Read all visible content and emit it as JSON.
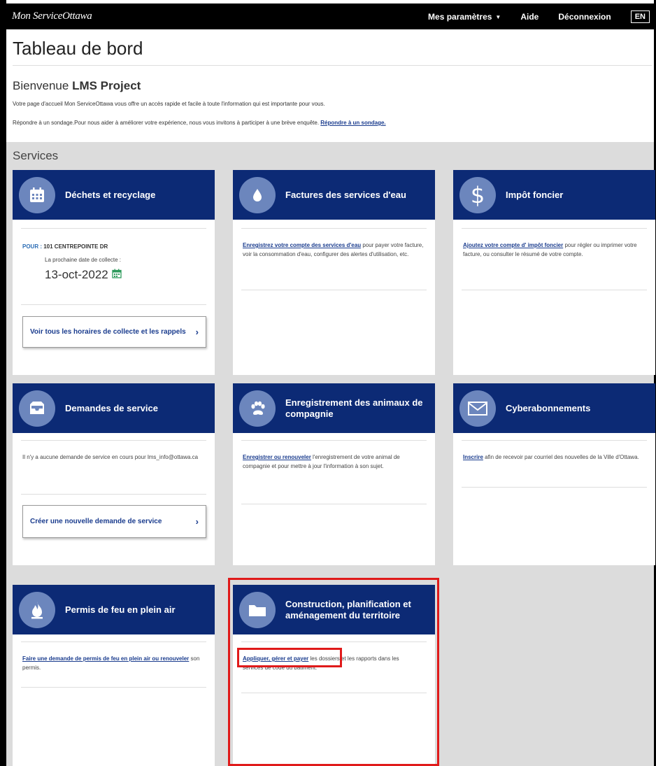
{
  "topbar": {
    "logo": "Mon ServiceOttawa",
    "settings_label": "Mes paramètres",
    "help_label": "Aide",
    "logout_label": "Déconnexion",
    "lang_label": "EN"
  },
  "header": {
    "title": "Tableau de bord",
    "welcome_prefix": "Bienvenue ",
    "welcome_name": "LMS Project",
    "intro": "Votre page d'accueil Mon ServiceOttawa vous offre un accès rapide et facile à toute l'information qui est importante pour vous.",
    "survey_text": "Répondre à un sondage.Pour nous aider à améliorer votre expérience, nous vous invitons à participer à une brève enquête. ",
    "survey_link": "Répondre à un sondage."
  },
  "services": {
    "title": "Services",
    "waste": {
      "title": "Déchets et recyclage",
      "pour_label": "POUR :",
      "address": "101 CENTREPOINTE DR",
      "next_label": "La prochaine date de collecte :",
      "next_date": "13-oct-2022",
      "button": "Voir tous les horaires de collecte et les rappels"
    },
    "water": {
      "title": "Factures des services d'eau",
      "link": "Enregistrez votre compte des services d'eau",
      "text": " pour payer votre facture, voir la consommation d'eau, configurer des alertes d'utilisation, etc."
    },
    "tax": {
      "title": "Impôt foncier",
      "link": "Ajoutez votre compte d' impôt foncier",
      "text": " pour régler ou imprimer votre facture, ou consulter le résumé de votre compte."
    },
    "requests": {
      "title": "Demandes de service",
      "text": "Il n'y a aucune demande de service en cours pour lms_info@ottawa.ca",
      "button": "Créer une nouvelle demande de service"
    },
    "pets": {
      "title": "Enregistrement des animaux de compagnie",
      "link": "Enregistrer ou renouveler",
      "text": " l'enregistrement de votre animal de compagnie et pour mettre à jour l'information à son sujet."
    },
    "subscriptions": {
      "title": "Cyberabonnements",
      "link": "Inscrire",
      "text": " afin de recevoir par courriel des nouvelles de la Ville d'Ottawa."
    },
    "fire": {
      "title": "Permis de feu en plein air",
      "link": "Faire une demande de permis de feu en plein air ou renouveler",
      "text": " son permis."
    },
    "building": {
      "title": "Construction, planification et aménagement du territoire",
      "link": "Appliquer, gérer et payer",
      "text": " les dossiers et les rapports dans les services de code du bâtiment."
    }
  },
  "colors": {
    "card_header": "#0c2a75",
    "icon_circle": "#6c86bd",
    "link": "#1a3c8e",
    "highlight": "#e01a1a"
  }
}
